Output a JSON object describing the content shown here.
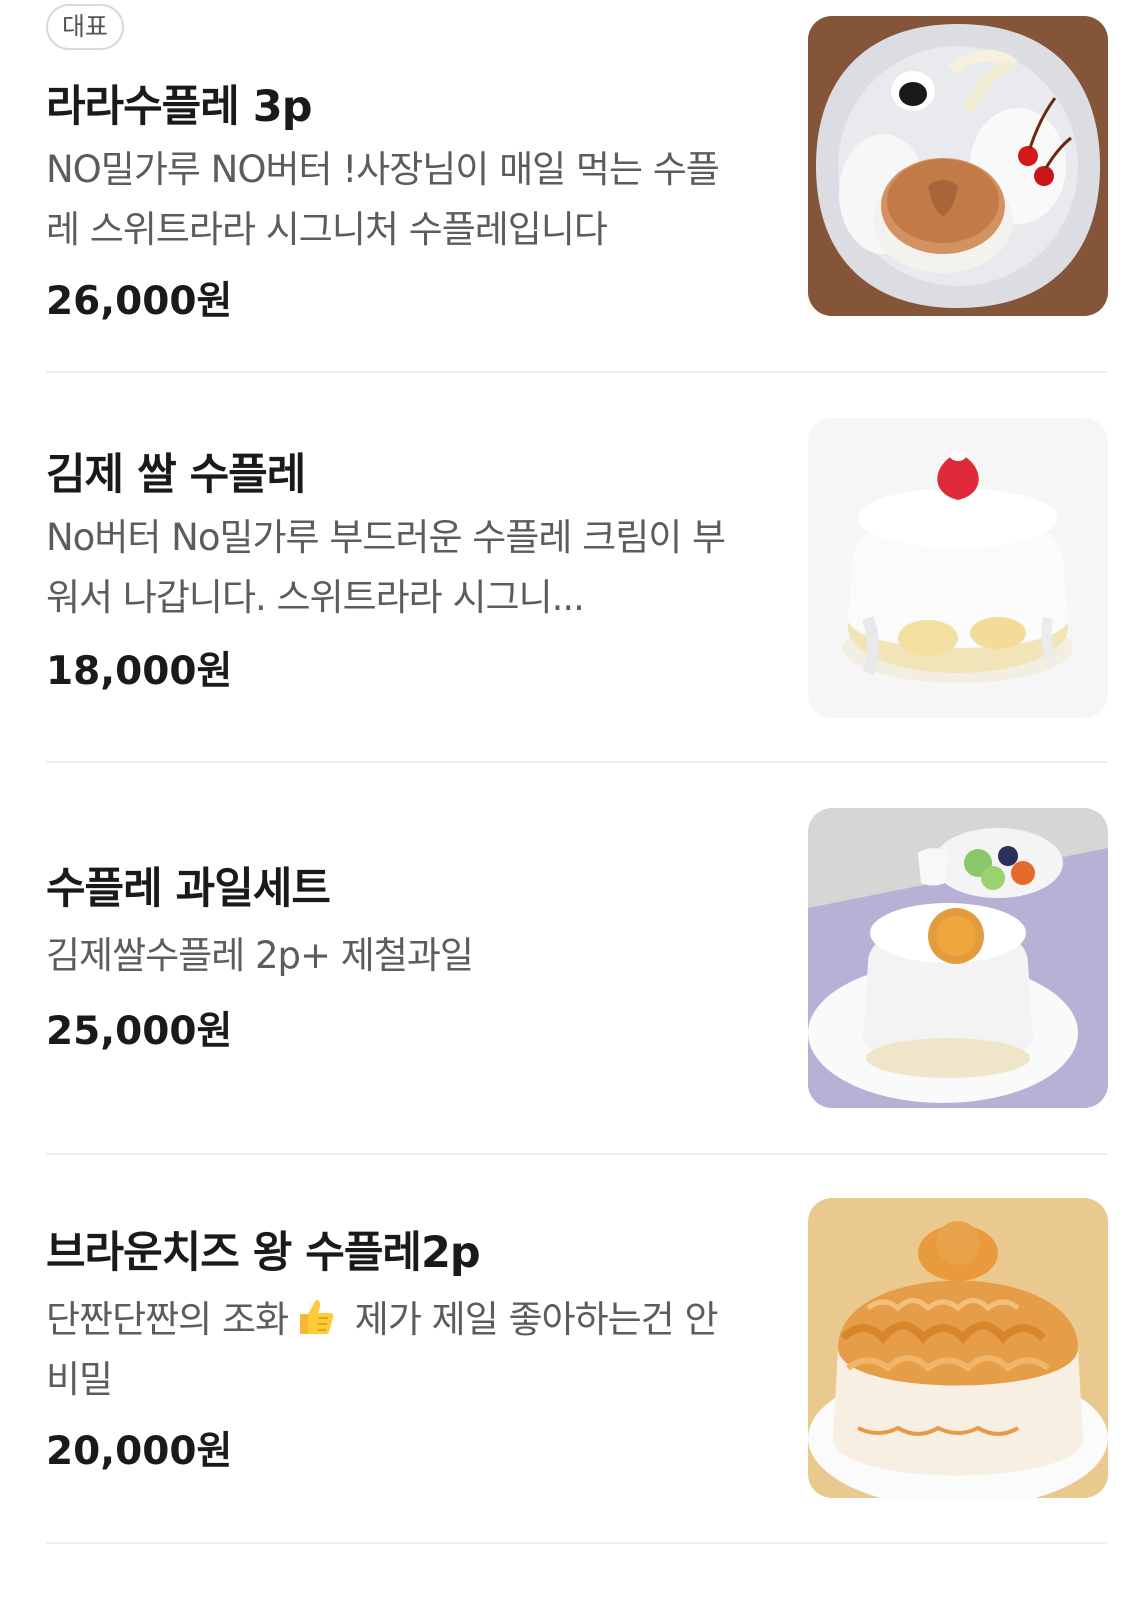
{
  "menu": {
    "items": [
      {
        "badge": "대표",
        "title": "라라수플레 3p",
        "description": "NO밀가루 NO버터 !사장님이 매일 먹는 수플레 스위트라라 시그니처 수플레입니다",
        "price": "26,000원",
        "image_icon": "souffle-pancake-plate-photo"
      },
      {
        "title": "김제 쌀 수플레",
        "description": "No버터 No밀가루 부드러운 수플레 크림이 부워서 나갑니다. 스위트라라 시그니...",
        "price": "18,000원",
        "image_icon": "rice-souffle-strawberry-photo"
      },
      {
        "title": "수플레 과일세트",
        "description": "김제쌀수플레 2p+ 제철과일",
        "price": "25,000원",
        "image_icon": "souffle-fruit-set-photo"
      },
      {
        "title": "브라운치즈 왕 수플레2p",
        "description_before": "단짠단짠의 조화",
        "description_emoji": "thumbs-up-icon",
        "description_after": " 제가 제일 좋아하는건 안비밀",
        "price": "20,000원",
        "image_icon": "brown-cheese-souffle-photo"
      }
    ]
  }
}
